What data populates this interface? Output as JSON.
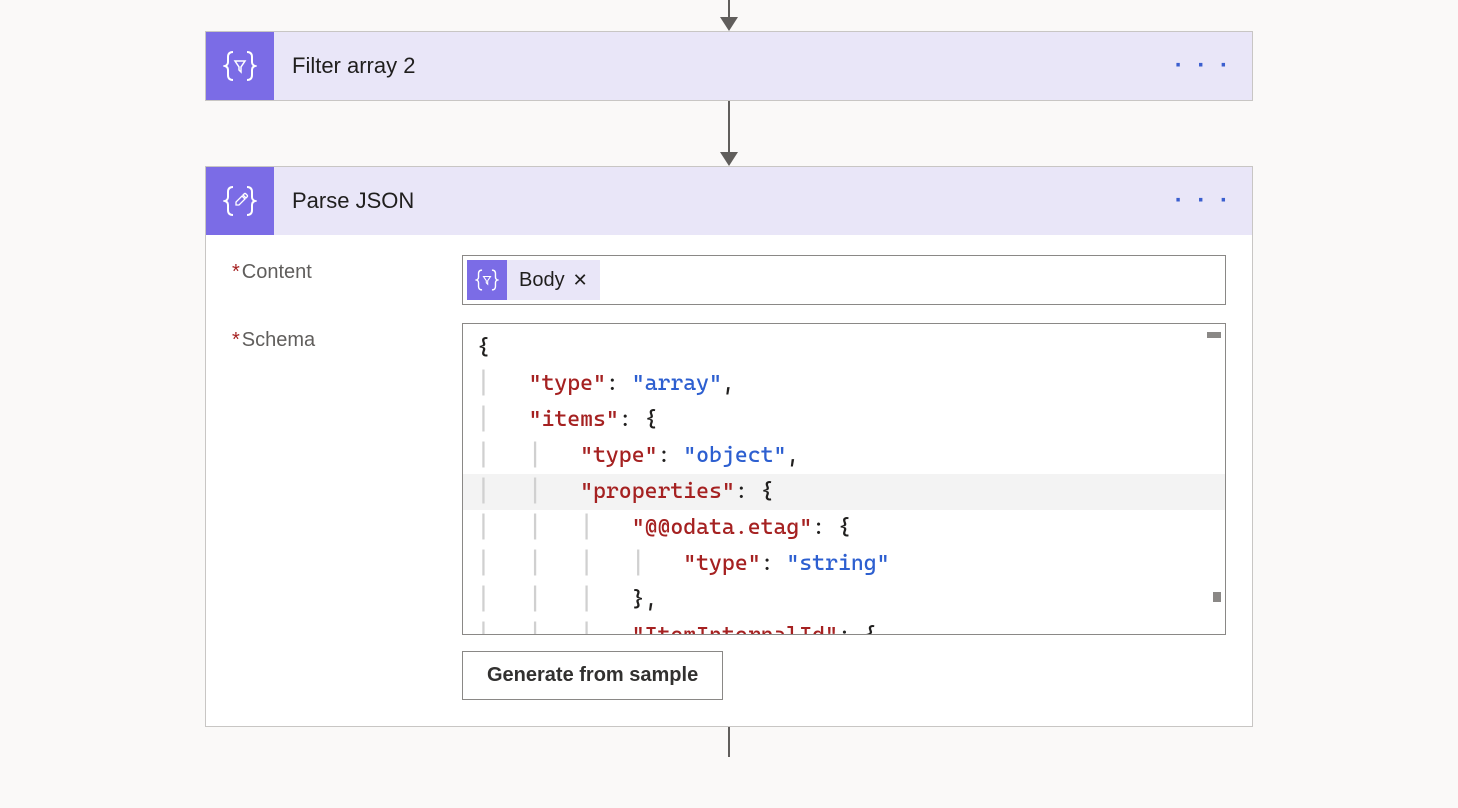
{
  "cards": {
    "filter": {
      "title": "Filter array 2"
    },
    "parse": {
      "title": "Parse JSON"
    }
  },
  "labels": {
    "content": "Content",
    "schema": "Schema"
  },
  "token": {
    "label": "Body",
    "close": "✕"
  },
  "schema_json": {
    "line1": "{",
    "line2_key": "\"type\"",
    "line2_val": "\"array\"",
    "line3_key": "\"items\"",
    "line4_key": "\"type\"",
    "line4_val": "\"object\"",
    "line5_key": "\"properties\"",
    "line6_key": "\"@@odata.etag\"",
    "line7_key": "\"type\"",
    "line7_val": "\"string\"",
    "line9_key": "\"ItemInternalId\""
  },
  "buttons": {
    "generate": "Generate from sample"
  },
  "menu_dots": "· · ·"
}
